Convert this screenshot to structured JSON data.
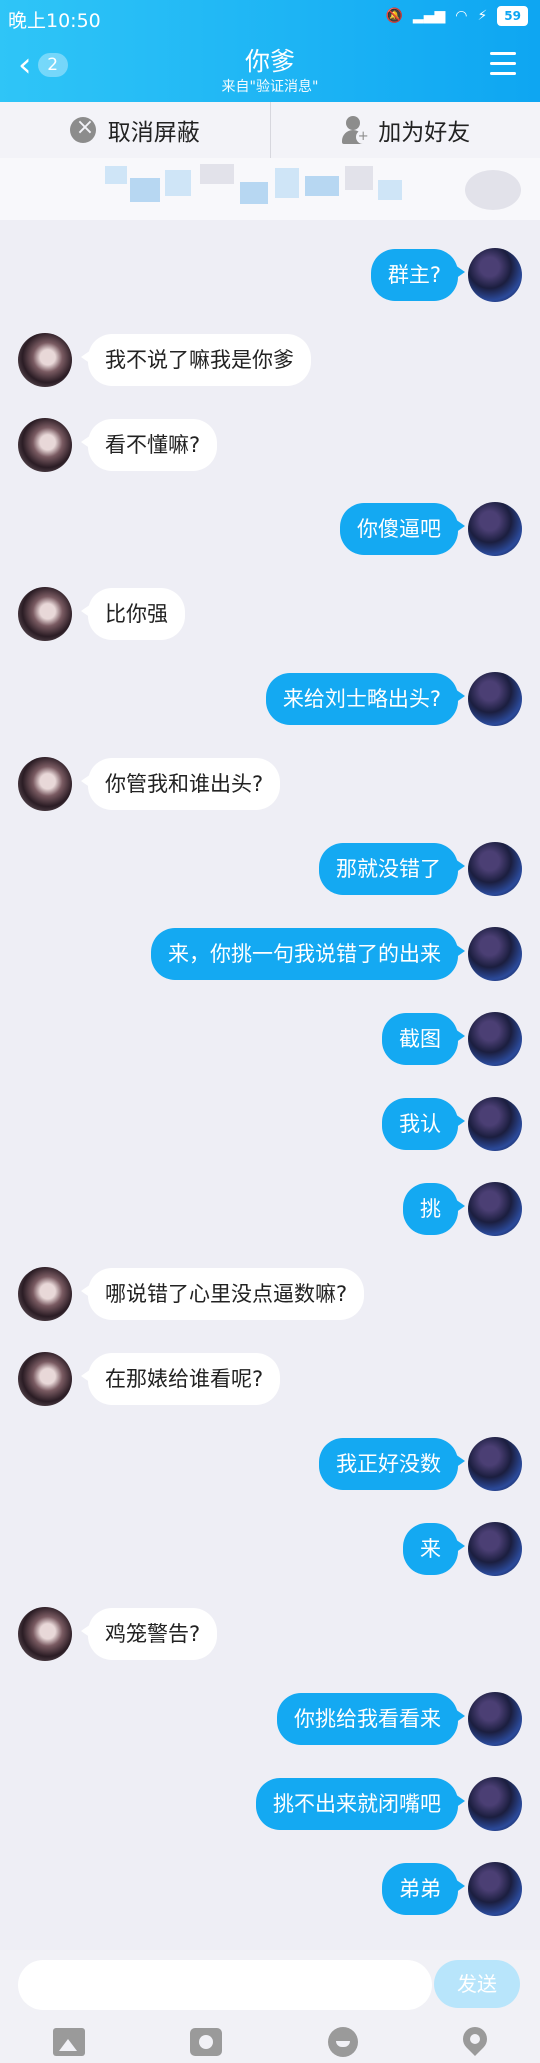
{
  "status": {
    "time": "晚上10:50",
    "battery": "59"
  },
  "header": {
    "back_count": "2",
    "title": "你爹",
    "subtitle": "来自\"验证消息\""
  },
  "actions": {
    "unblock": "取消屏蔽",
    "add_friend": "加为好友"
  },
  "messages": [
    {
      "side": "right",
      "text": "群主?"
    },
    {
      "side": "left",
      "text": "我不说了嘛我是你爹"
    },
    {
      "side": "left",
      "text": "看不懂嘛?"
    },
    {
      "side": "right",
      "text": "你傻逼吧"
    },
    {
      "side": "left",
      "text": "比你强"
    },
    {
      "side": "right",
      "text": "来给刘士略出头?"
    },
    {
      "side": "left",
      "text": "你管我和谁出头?"
    },
    {
      "side": "right",
      "text": "那就没错了"
    },
    {
      "side": "right",
      "text": "来，你挑一句我说错了的出来"
    },
    {
      "side": "right",
      "text": "截图"
    },
    {
      "side": "right",
      "text": "我认"
    },
    {
      "side": "right",
      "text": "挑"
    },
    {
      "side": "left",
      "text": "哪说错了心里没点逼数嘛?"
    },
    {
      "side": "left",
      "text": "在那婊给谁看呢?"
    },
    {
      "side": "right",
      "text": "我正好没数"
    },
    {
      "side": "right",
      "text": "来"
    },
    {
      "side": "left",
      "text": "鸡笼警告?"
    },
    {
      "side": "right",
      "text": "你挑给我看看来"
    },
    {
      "side": "right",
      "text": "挑不出来就闭嘴吧"
    },
    {
      "side": "right",
      "text": "弟弟"
    }
  ],
  "input": {
    "placeholder": "",
    "send_label": "发送"
  },
  "toolbar_icons": [
    "image-icon",
    "camera-icon",
    "emoji-icon",
    "location-icon"
  ]
}
